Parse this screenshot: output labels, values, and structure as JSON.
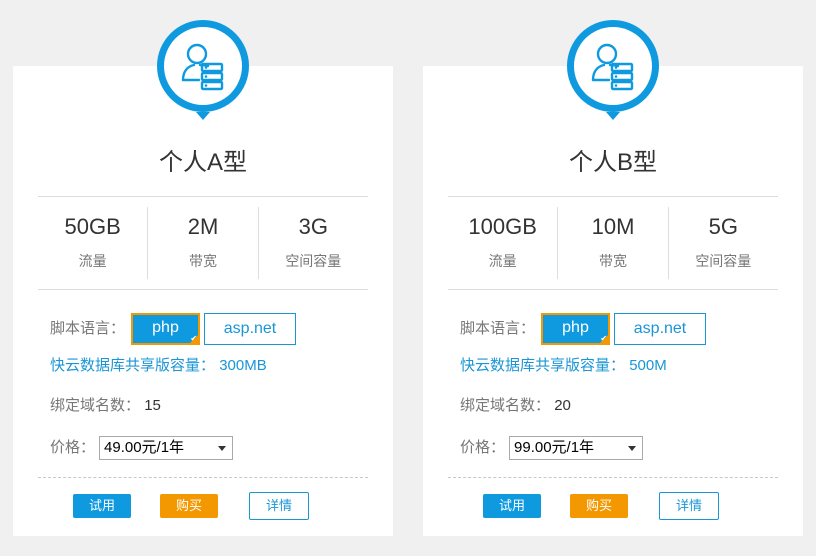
{
  "colors": {
    "brand_blue": "#0f9ae0",
    "accent_orange": "#f39800",
    "text_dark": "#333333",
    "text_gray": "#777777",
    "divider": "#dddddd",
    "background": "#f0f0f0"
  },
  "labels": {
    "traffic": "流量",
    "bandwidth": "带宽",
    "space": "空间容量",
    "script_lang": "脚本语言：",
    "db_capacity": "快云数据库共享版容量：",
    "bind_domains": "绑定域名数：",
    "price": "价格："
  },
  "buttons": {
    "php": "php",
    "asp": "asp.net",
    "try": "试用",
    "buy": "购买",
    "detail": "详情"
  },
  "icons": {
    "badge": "user-server-icon",
    "selected": "check-corner-icon",
    "dropdown": "chevron-down-icon"
  },
  "plans": [
    {
      "title": "个人A型",
      "traffic": "50GB",
      "bandwidth": "2M",
      "space": "3G",
      "db_capacity": "300MB",
      "domains": "15",
      "price": "49.00元/1年",
      "selected_lang": "php"
    },
    {
      "title": "个人B型",
      "traffic": "100GB",
      "bandwidth": "10M",
      "space": "5G",
      "db_capacity": "500M",
      "domains": "20",
      "price": "99.00元/1年",
      "selected_lang": "php"
    }
  ]
}
